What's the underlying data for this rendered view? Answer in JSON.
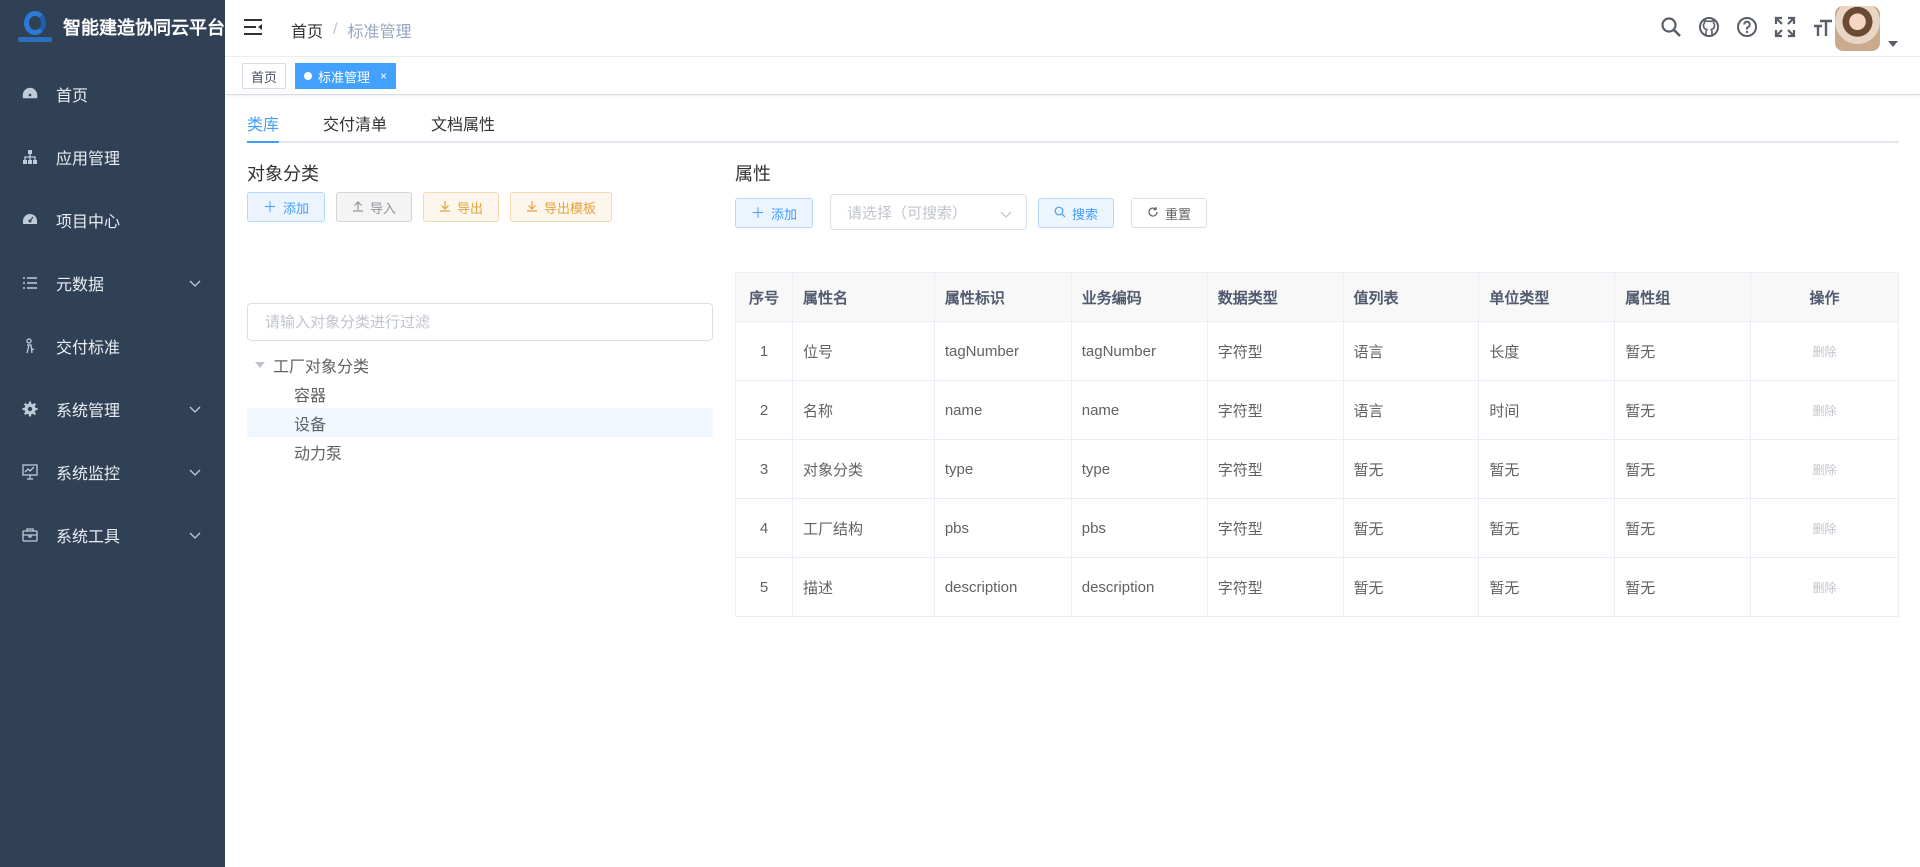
{
  "app": {
    "title": "智能建造协同云平台",
    "logo_icon": "company-logo"
  },
  "sidebar": {
    "items": [
      {
        "label": "首页",
        "icon": "dashboard-icon",
        "expandable": false
      },
      {
        "label": "应用管理",
        "icon": "tree-icon",
        "expandable": false
      },
      {
        "label": "项目中心",
        "icon": "dashboard-icon",
        "expandable": false
      },
      {
        "label": "元数据",
        "icon": "list-icon",
        "expandable": true
      },
      {
        "label": "交付标准",
        "icon": "guide-icon",
        "expandable": false
      },
      {
        "label": "系统管理",
        "icon": "gear-icon",
        "expandable": true
      },
      {
        "label": "系统监控",
        "icon": "monitor-icon",
        "expandable": true
      },
      {
        "label": "系统工具",
        "icon": "toolbox-icon",
        "expandable": true
      }
    ]
  },
  "header": {
    "breadcrumb": {
      "home": "首页",
      "separator": "/",
      "current": "标准管理"
    },
    "tools": [
      "search-icon",
      "github-icon",
      "question-icon",
      "fullscreen-icon",
      "font-size-icon"
    ]
  },
  "tags": {
    "home": "首页",
    "active": "标准管理",
    "close": "×"
  },
  "tabs": [
    "类库",
    "交付清单",
    "文档属性"
  ],
  "left_panel": {
    "title": "对象分类",
    "buttons": {
      "add": "添加",
      "import": "导入",
      "export": "导出",
      "export_template": "导出模板"
    },
    "filter_placeholder": "请输入对象分类进行过滤",
    "tree": {
      "root": "工厂对象分类",
      "children": [
        "容器",
        "设备",
        "动力泵"
      ],
      "selected_index": 1
    }
  },
  "right_panel": {
    "title": "属性",
    "buttons": {
      "add": "添加",
      "search": "搜索",
      "reset": "重置"
    },
    "select_placeholder": "请选择（可搜索）",
    "table": {
      "headers": [
        "序号",
        "属性名",
        "属性标识",
        "业务编码",
        "数据类型",
        "值列表",
        "单位类型",
        "属性组",
        "操作"
      ],
      "rows": [
        [
          "1",
          "位号",
          "tagNumber",
          "tagNumber",
          "字符型",
          "语言",
          "长度",
          "暂无",
          "删除"
        ],
        [
          "2",
          "名称",
          "name",
          "name",
          "字符型",
          "语言",
          "时间",
          "暂无",
          "删除"
        ],
        [
          "3",
          "对象分类",
          "type",
          "type",
          "字符型",
          "暂无",
          "暂无",
          "暂无",
          "删除"
        ],
        [
          "4",
          "工厂结构",
          "pbs",
          "pbs",
          "字符型",
          "暂无",
          "暂无",
          "暂无",
          "删除"
        ],
        [
          "5",
          "描述",
          "description",
          "description",
          "字符型",
          "暂无",
          "暂无",
          "暂无",
          "删除"
        ]
      ]
    }
  },
  "colors": {
    "sidebar_bg": "#304156",
    "primary": "#409eff",
    "warning": "#e6a23c",
    "tag_active": "#42a0ff"
  }
}
